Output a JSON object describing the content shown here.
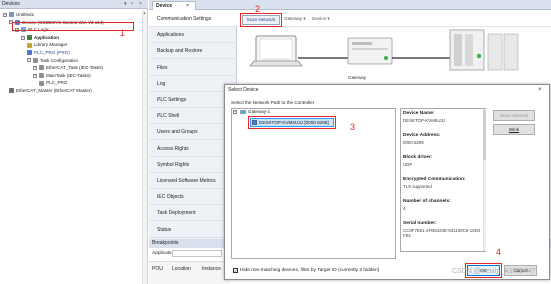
{
  "devices_panel": {
    "title": "Devices",
    "controls": [
      "▾",
      "ᵖ",
      "×"
    ],
    "tree": [
      {
        "label": "Untitled1",
        "indent": 0,
        "icon_color": "#7a93c0",
        "expander": "−"
      },
      {
        "label": "Device (CODESYS Control Win V3 x64)",
        "indent": 1,
        "icon_color": "#5a7fb8",
        "expander": "−"
      },
      {
        "label": "PLC Logic",
        "indent": 2,
        "icon_color": "#6fa8dc",
        "expander": "−"
      },
      {
        "label": "Application",
        "indent": 3,
        "icon_color": "#3f7d3f",
        "expander": "−",
        "bold": true
      },
      {
        "label": "Library Manager",
        "indent": 4,
        "icon_color": "#c9a13b",
        "expander": ""
      },
      {
        "label": "PLC_PRG (PRG)",
        "indent": 4,
        "icon_color": "#4a78c2",
        "expander": "",
        "link": true
      },
      {
        "label": "Task Configuration",
        "indent": 4,
        "icon_color": "#8e8e8e",
        "expander": "−"
      },
      {
        "label": "EtherCAT_Task (IEC-Tasks)",
        "indent": 5,
        "icon_color": "#8e8e8e",
        "expander": "−"
      },
      {
        "label": "MainTask (IEC-Tasks)",
        "indent": 5,
        "icon_color": "#8e8e8e",
        "expander": "−"
      },
      {
        "label": "PLC_PRG",
        "indent": 6,
        "icon_color": "#8e8e8e",
        "expander": ""
      },
      {
        "label": "EtherCAT_Master (EtherCAT Master)",
        "indent": 1,
        "icon_color": "#6b6b6b",
        "expander": ""
      }
    ]
  },
  "editor": {
    "tab_label": "Device",
    "tab_close": "×",
    "nav_items": [
      "Communication Settings",
      "Applications",
      "Backup and Restore",
      "Files",
      "Log",
      "PLC Settings",
      "PLC Shell",
      "Users and Groups",
      "Access Rights",
      "Symbol Rights",
      "Licensed Software Metrics",
      "IEC Objects",
      "Task Deployment",
      "Status"
    ],
    "scan_network_label": "Scan Network",
    "crumbs": [
      "Gateway ▾",
      "Device ▾"
    ],
    "gateway_label": "Gateway"
  },
  "breakpoints": {
    "title": "Breakpoints",
    "application_label": "Application:",
    "columns": [
      "POU",
      "Location",
      "Instance"
    ]
  },
  "dialog": {
    "title": "Select Device",
    "close": "×",
    "subtitle": "Select the Network Path to the Controller",
    "tree": {
      "gateway": "Gateway-1",
      "device": "DESKTOP-KVM6U3J [0000.8296]"
    },
    "info": [
      {
        "label": "Device Name:",
        "value": "DESKTOP-KVM6U3J"
      },
      {
        "label": "Device Address:",
        "value": "0000.8296"
      },
      {
        "label": "Block driver:",
        "value": "UDP"
      },
      {
        "label": "Encrypted Communication:",
        "value": "TLS supported"
      },
      {
        "label": "Number of channels:",
        "value": "4"
      },
      {
        "label": "Serial number:",
        "value": "CC8F7E51-4FB8423E-631100C6-16D2F83"
      }
    ],
    "buttons": {
      "scan_network": "Scan Network",
      "wink": "Wink",
      "ok": "OK",
      "cancel": "Cancel"
    },
    "hide_label": "Hide non-matching devices, filter by Target ID (currently 2 hidden)",
    "hide_checked": "✓"
  },
  "annotations": [
    "1",
    "2",
    "3",
    "4"
  ],
  "watermark": "CSDN @weixin_43783447",
  "colors": {
    "highlight_red": "#e8262a",
    "selection_blue": "#cce4f7",
    "selection_border": "#3399ff",
    "panel_header": "#d9e1ee"
  }
}
